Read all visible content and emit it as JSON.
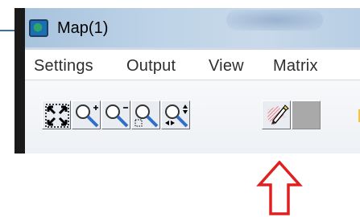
{
  "window": {
    "title": "Map(1)"
  },
  "menu": {
    "items": [
      {
        "label": "Settings"
      },
      {
        "label": "Output"
      },
      {
        "label": "View"
      },
      {
        "label": "Matrix"
      }
    ]
  },
  "toolbar": {
    "buttons": [
      {
        "icon": "fit-extent-icon"
      },
      {
        "icon": "zoom-in-icon"
      },
      {
        "icon": "zoom-out-icon"
      },
      {
        "icon": "zoom-selection-icon"
      },
      {
        "icon": "zoom-step-icon"
      },
      {
        "icon": "edit-pencil-icon"
      },
      {
        "icon": "blank-disabled-icon"
      }
    ]
  },
  "annotation": {
    "arrow_color": "#e02020"
  }
}
